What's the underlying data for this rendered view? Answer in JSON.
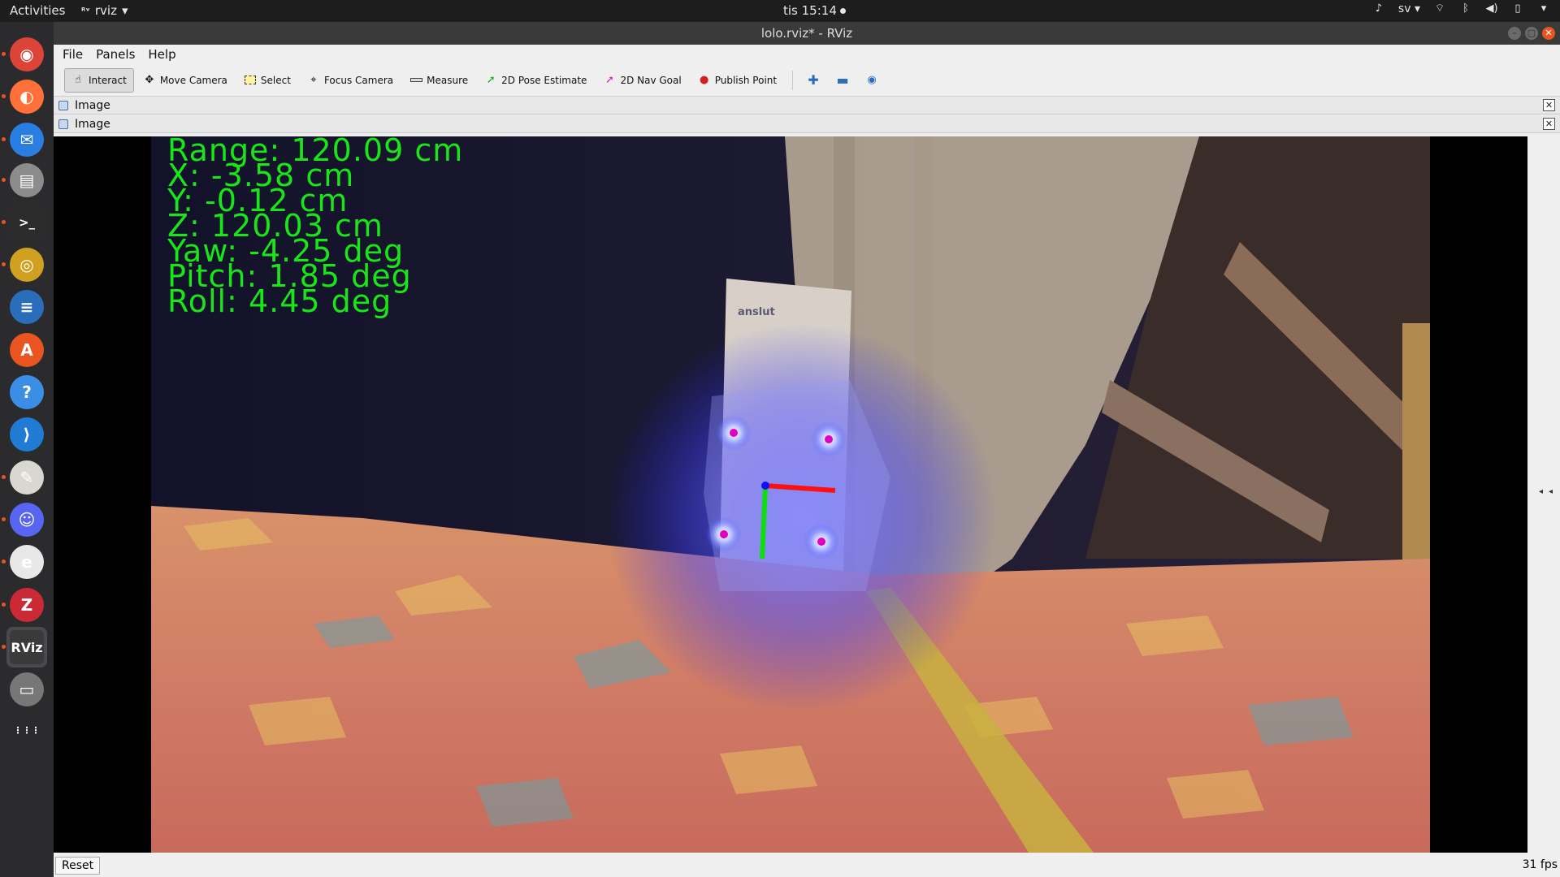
{
  "topbar": {
    "activities": "Activities",
    "app_name": "rviz",
    "clock": "tis 15:14",
    "lang": "sv"
  },
  "dock": {
    "items": [
      {
        "name": "chrome",
        "color": "#db4437",
        "glyph": "◉"
      },
      {
        "name": "firefox",
        "color": "#ff7139",
        "glyph": "◐"
      },
      {
        "name": "thunderbird",
        "color": "#2a7de1",
        "glyph": "✉"
      },
      {
        "name": "files",
        "color": "#8c8c8c",
        "glyph": "▤"
      },
      {
        "name": "terminal",
        "color": "#2c2c2c",
        "glyph": ">_"
      },
      {
        "name": "rhythmbox",
        "color": "#d0a020",
        "glyph": "◎"
      },
      {
        "name": "writer",
        "color": "#2a6ebb",
        "glyph": "≡"
      },
      {
        "name": "software",
        "color": "#e95420",
        "glyph": "A"
      },
      {
        "name": "help",
        "color": "#3b8ee6",
        "glyph": "?"
      },
      {
        "name": "vscode",
        "color": "#1f7bd3",
        "glyph": "⟩"
      },
      {
        "name": "text-editor",
        "color": "#d8d8d0",
        "glyph": "✎"
      },
      {
        "name": "discord",
        "color": "#5865f2",
        "glyph": "☺"
      },
      {
        "name": "app-red",
        "color": "#e8e8e8",
        "glyph": "e"
      },
      {
        "name": "zotero",
        "color": "#cc2936",
        "glyph": "Z"
      },
      {
        "name": "rviz",
        "color": "#3a3a3a",
        "glyph": "RViz"
      },
      {
        "name": "usb-drive",
        "color": "#777777",
        "glyph": "▭"
      },
      {
        "name": "show-apps",
        "color": "#2b2b2e",
        "glyph": "⋮⋮⋮"
      }
    ]
  },
  "window": {
    "title": "lolo.rviz* - RViz",
    "menu": {
      "file": "File",
      "panels": "Panels",
      "help": "Help"
    },
    "toolbar": {
      "interact": "Interact",
      "move_camera": "Move Camera",
      "select": "Select",
      "focus_camera": "Focus Camera",
      "measure": "Measure",
      "pose_estimate": "2D Pose Estimate",
      "nav_goal": "2D Nav Goal",
      "publish_point": "Publish Point"
    },
    "panels": [
      {
        "title": "Image"
      },
      {
        "title": "Image"
      }
    ]
  },
  "overlay": {
    "range": "Range: 120.09 cm",
    "x": "X: -3.58 cm",
    "y": "Y: -0.12 cm",
    "z": "Z: 120.03 cm",
    "yaw": "Yaw: -4.25 deg",
    "pitch": "Pitch: 1.85 deg",
    "roll": "Roll: 4.45 deg",
    "color": "#19e619"
  },
  "camera_scene": {
    "box_label": "anslut"
  },
  "statusbar": {
    "reset": "Reset",
    "fps": "31 fps"
  }
}
